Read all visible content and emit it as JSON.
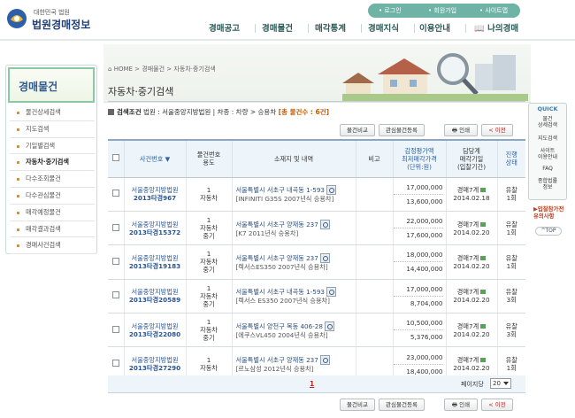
{
  "header": {
    "logo_small": "대한민국 법원",
    "logo_big": "법원경매정보",
    "util": [
      "로그인",
      "회원가입",
      "사이트맵"
    ],
    "gnb": [
      "경매공고",
      "경매물건",
      "매각통계",
      "경매지식",
      "이용안내",
      "나의경매"
    ]
  },
  "lnb": {
    "title": "경매물건",
    "items": [
      "물건상세검색",
      "지도검색",
      "기일별검색",
      "자동차·중기검색",
      "다수조회물건",
      "다수관심물건",
      "매각예정물건",
      "매각결과검색",
      "경매사건검색"
    ],
    "active_index": 3
  },
  "breadcrumb": {
    "home": "HOME",
    "sep": ">",
    "path": [
      "경매물건",
      "자동차·중기검색"
    ]
  },
  "page_title": "자동차·중기검색",
  "quick": {
    "title": "QUICK",
    "items": [
      "물건\n상세검색",
      "지도검색",
      "사이트\n이용안내",
      "FAQ",
      "종합법률\n정보"
    ],
    "notice": "입찰참가전\n유의사항",
    "top": "TOP"
  },
  "search": {
    "label": "검색조건",
    "text": "법원 : 서울중앙지방법원 | 차종 : 차량 > 승용차",
    "count": "[총 물건수 : 6건]"
  },
  "buttons": {
    "compare": "물건비교",
    "interest": "관심물건등록",
    "print": "인쇄",
    "prev": "이전"
  },
  "columns": [
    "사건번호",
    "물건번호\n용도",
    "소재지 및 내역",
    "비고",
    "감정평가액\n최저매각가격\n(단위:원)",
    "담당계\n매각기일\n(입찰기간)",
    "진행\n상태"
  ],
  "rows": [
    {
      "court": "서울중앙지방법원",
      "case": "2013타경967",
      "no": "1",
      "use": "자동차",
      "addr": "서울특별시 서초구 내곡동 1-593",
      "desc": "[INFINITI G35S 2007년식 승용차]",
      "note": "",
      "appraisal": "17,000,000",
      "min": "13,600,000",
      "dept": "경매7계",
      "date": "2014.02.18",
      "status": "유찰",
      "times": "1회"
    },
    {
      "court": "서울중앙지방법원",
      "case": "2013타경15372",
      "no": "1",
      "use": "자동차\n중기",
      "addr": "서울특별시 서초구 양재동 237",
      "desc": "[K7 2011년식 승용차]",
      "note": "",
      "appraisal": "22,000,000",
      "min": "17,600,000",
      "dept": "경매7계",
      "date": "2014.02.20",
      "status": "유찰",
      "times": "1회"
    },
    {
      "court": "서울중앙지방법원",
      "case": "2013타경19183",
      "no": "1",
      "use": "자동차\n중기",
      "addr": "서울특별시 서초구 양재동 237",
      "desc": "[렉서스ES350 2007년식 승용차]",
      "note": "",
      "appraisal": "18,000,000",
      "min": "14,400,000",
      "dept": "경매7계",
      "date": "2014.02.20",
      "status": "유찰",
      "times": "1회"
    },
    {
      "court": "서울중앙지방법원",
      "case": "2013타경20589",
      "no": "1",
      "use": "자동차\n중기",
      "addr": "서울특별시 서초구 내곡동 1-593",
      "desc": "[렉서스 ES350 2007년식 승용차]",
      "note": "",
      "appraisal": "17,000,000",
      "min": "8,704,000",
      "dept": "경매7계",
      "date": "2014.02.20",
      "status": "유찰",
      "times": "3회"
    },
    {
      "court": "서울중앙지방법원",
      "case": "2013타경22080",
      "no": "1",
      "use": "자동차\n중기",
      "addr": "서울특별시 양천구 목동 406-28",
      "desc": "[에쿠스VL450 2004년식 승용차]",
      "note": "",
      "appraisal": "10,500,000",
      "min": "5,376,000",
      "dept": "경매7계",
      "date": "2014.02.20",
      "status": "유찰",
      "times": "3회"
    },
    {
      "court": "서울중앙지방법원",
      "case": "2013타경27290",
      "no": "1",
      "use": "자동차",
      "addr": "서울특별시 서초구 양재동 237",
      "desc": "[르노삼성 2012년식 승용차]",
      "note": "",
      "appraisal": "23,000,000",
      "min": "18,400,000",
      "dept": "경매7계",
      "date": "2014.02.20",
      "status": "유찰",
      "times": "1회"
    }
  ],
  "pager": {
    "current": "1",
    "per_page_label": "페이지당",
    "per_page": "20"
  }
}
